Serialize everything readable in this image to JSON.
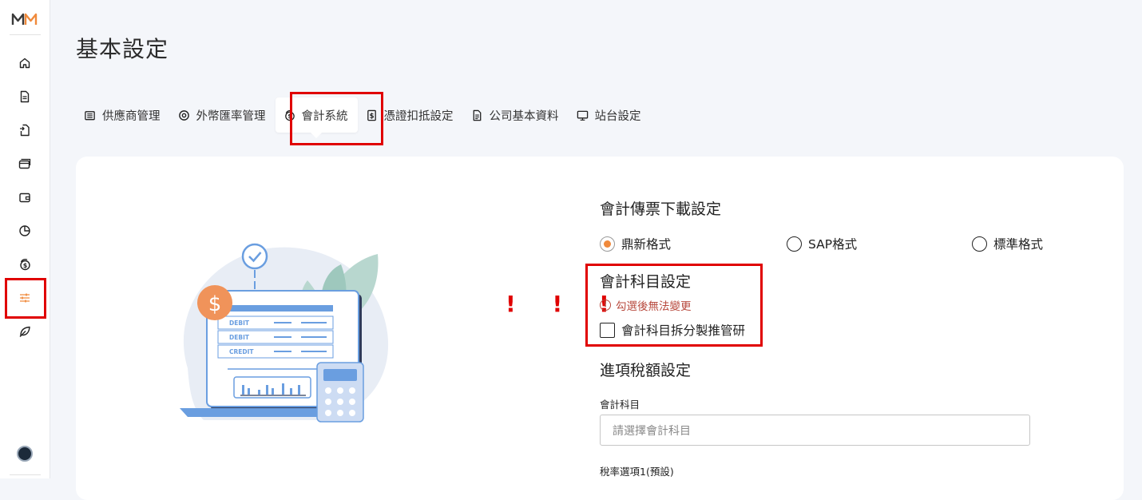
{
  "sidebar": {
    "logo_text": "MM",
    "items": [
      {
        "name": "home-icon"
      },
      {
        "name": "document-icon"
      },
      {
        "name": "file-return-icon"
      },
      {
        "name": "card-icon"
      },
      {
        "name": "wallet-icon"
      },
      {
        "name": "pie-chart-icon"
      },
      {
        "name": "coin-icon"
      },
      {
        "name": "sliders-icon",
        "active": true
      },
      {
        "name": "leaf-icon"
      }
    ],
    "accent_color": "#f08a3c"
  },
  "page": {
    "title": "基本設定"
  },
  "tabs": [
    {
      "label": "供應商管理",
      "icon": "building-icon"
    },
    {
      "label": "外幣匯率管理",
      "icon": "target-icon"
    },
    {
      "label": "會計系統",
      "icon": "dollar-coin-icon",
      "active": true
    },
    {
      "label": "憑證扣抵設定",
      "icon": "dollar-doc-icon"
    },
    {
      "label": "公司基本資料",
      "icon": "file-text-icon"
    },
    {
      "label": "站台設定",
      "icon": "monitor-icon"
    }
  ],
  "illustration": {
    "rows": [
      "DEBIT",
      "DEBIT",
      "CREDIT"
    ],
    "currency_symbol": "$"
  },
  "annotation": {
    "exclamations": "! ! !"
  },
  "settings": {
    "download": {
      "title": "會計傳票下載設定",
      "options": [
        {
          "label": "鼎新格式",
          "selected": true
        },
        {
          "label": "SAP格式",
          "selected": false
        },
        {
          "label": "標準格式",
          "selected": false
        }
      ]
    },
    "account": {
      "title": "會計科目設定",
      "warning": "勾選後無法變更",
      "checkbox_label": "會計科目拆分製推管研",
      "checked": false
    },
    "tax": {
      "title": "進項稅額設定",
      "field_label": "會計科目",
      "select_placeholder": "請選擇會計科目",
      "rate_label": "稅率選項1(預設)"
    }
  },
  "colors": {
    "highlight": "#e00000",
    "warning": "#b84a3e",
    "radio_selected": "#f08a3c"
  }
}
